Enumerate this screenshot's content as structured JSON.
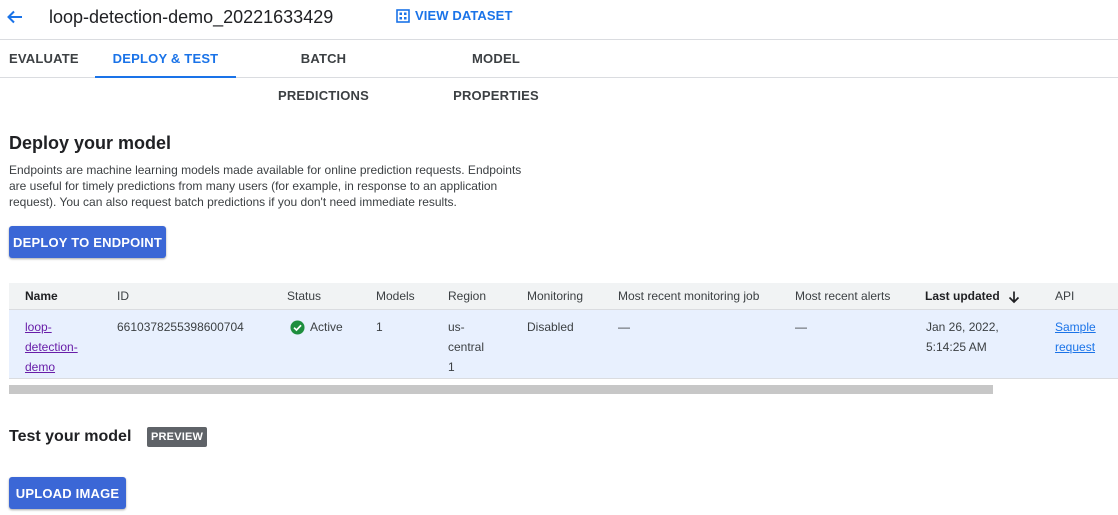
{
  "header": {
    "title": "loop-detection-demo_20221633429",
    "view_dataset_label": "VIEW DATASET"
  },
  "tabs": [
    {
      "label": "EVALUATE",
      "active": false
    },
    {
      "label": "DEPLOY & TEST",
      "active": true
    },
    {
      "label": "BATCH PREDICTIONS",
      "active": false
    },
    {
      "label": "MODEL PROPERTIES",
      "active": false
    }
  ],
  "deploy": {
    "heading": "Deploy your model",
    "description": "Endpoints are machine learning models made available for online prediction requests. Endpoints are useful for timely predictions from many users (for example, in response to an application request). You can also request batch predictions if you don't need immediate results.",
    "button_label": "DEPLOY TO ENDPOINT"
  },
  "table": {
    "columns": [
      "Name",
      "ID",
      "Status",
      "Models",
      "Region",
      "Monitoring",
      "Most recent monitoring job",
      "Most recent alerts",
      "Last updated",
      "API"
    ],
    "sort_column": "Last updated",
    "sort_direction": "descending",
    "rows": [
      {
        "name": "loop-detection-demo",
        "id": "6610378255398600704",
        "status": "Active",
        "models": "1",
        "region": "us-central1",
        "monitoring": "Disabled",
        "recent_job": "—",
        "recent_alerts": "—",
        "last_updated": "Jan 26, 2022, 5:14:25 AM",
        "api": "Sample request"
      }
    ]
  },
  "test": {
    "heading": "Test your model",
    "badge": "PREVIEW",
    "button_label": "UPLOAD IMAGE"
  },
  "colors": {
    "primary": "#3b67d6",
    "link": "#1a73e8",
    "visited_link": "#681da8",
    "status_active": "#1e8e3e",
    "row_highlight": "#e8f0fe"
  },
  "icons": {
    "back": "arrow-left-icon",
    "dataset": "grid-icon",
    "status": "check-circle-icon",
    "sort": "arrow-down-icon"
  }
}
